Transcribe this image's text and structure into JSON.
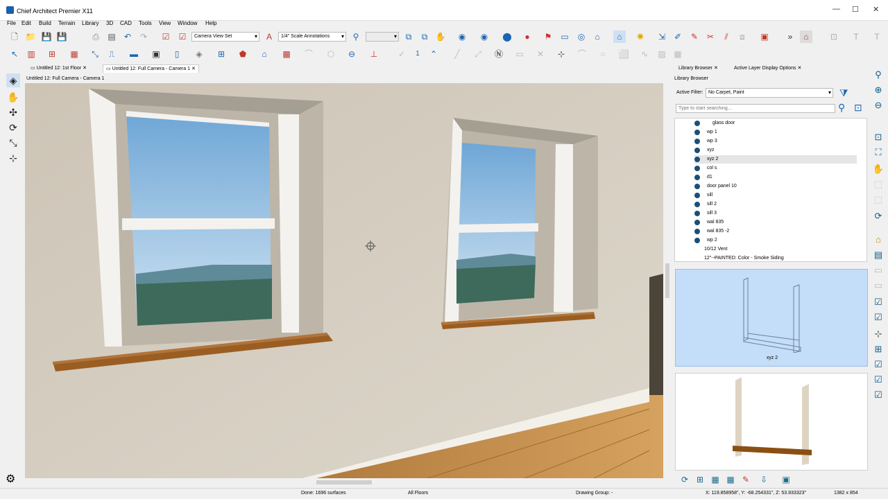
{
  "app": {
    "title": "Chief Architect Premier X11"
  },
  "menu": [
    "File",
    "Edit",
    "Build",
    "Terrain",
    "Library",
    "3D",
    "CAD",
    "Tools",
    "View",
    "Window",
    "Help"
  ],
  "toolbar": {
    "camera_view_set": "Camera View Set",
    "scale_annotations": "1/4\" Scale Annotations",
    "floor_number": "1"
  },
  "tabs": [
    {
      "label": "Untitled 12: 1st Floor"
    },
    {
      "label": "Untitled 12: Full Camera - Camera 1"
    }
  ],
  "view": {
    "header": "Untitled 12: Full Camera - Camera 1"
  },
  "library": {
    "tabs": [
      "Library Browser",
      "Active Layer Display Options"
    ],
    "header": "Library Browser",
    "filter_label": "Active Filter:",
    "filter_value": "No Carpet, Paint",
    "search_placeholder": "Type to start searching...",
    "items": [
      {
        "label": "glass door"
      },
      {
        "label": "wp 1"
      },
      {
        "label": "wp 3"
      },
      {
        "label": "xyz"
      },
      {
        "label": "xyz 2",
        "selected": true
      },
      {
        "label": "col s"
      },
      {
        "label": "d1"
      },
      {
        "label": "door panel 10"
      },
      {
        "label": "sill"
      },
      {
        "label": "sill 2"
      },
      {
        "label": "sill 3"
      },
      {
        "label": "wal 835"
      },
      {
        "label": "wal 835 -2"
      },
      {
        "label": "wp 2"
      },
      {
        "label": "10/12 Vent"
      },
      {
        "label": "12\"--PAINTED: Color - Smoke Siding"
      }
    ],
    "preview_caption": "xyz 2"
  },
  "status": {
    "done": "Done:  1696 surfaces",
    "floors": "All Floors",
    "drawing_group": "Drawing Group:  -",
    "coords": "X: 119.858958\", Y: -68.254331\", Z: 53.933323\"",
    "size": "1382 x 854"
  }
}
